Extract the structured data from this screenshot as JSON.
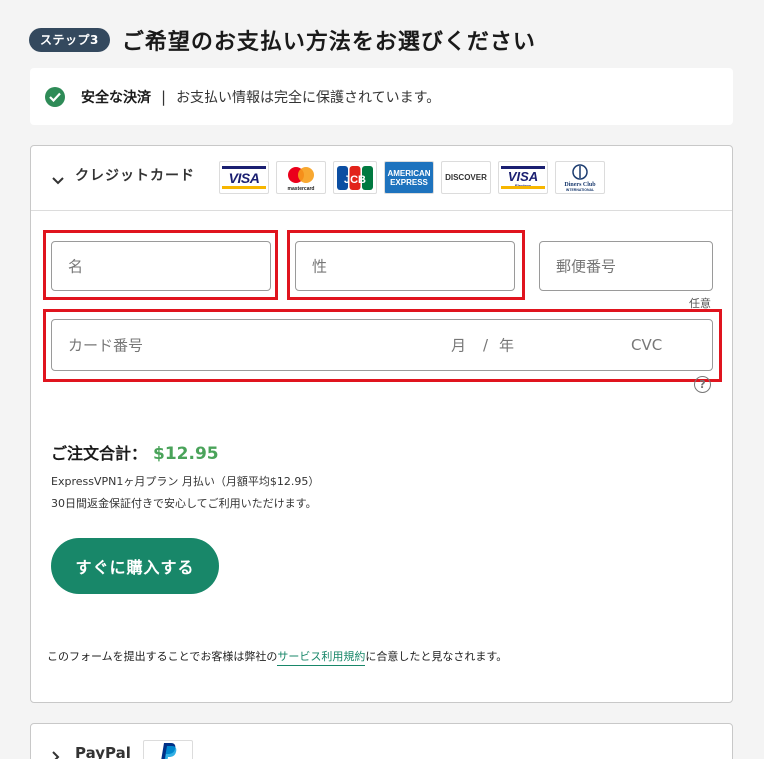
{
  "step": {
    "badge": "ステップ3",
    "title": "ご希望のお支払い方法をお選びください"
  },
  "secure": {
    "strong": "安全な決済",
    "separator": "|",
    "text": "お支払い情報は完全に保護されています。"
  },
  "credit_card": {
    "label": "クレジットカード",
    "logos": [
      "VISA",
      "mastercard",
      "JCB",
      "AMERICAN EXPRESS",
      "DISCOVER",
      "VISA Electron",
      "Diners Club INTERNATIONAL"
    ],
    "fields": {
      "first_name": "名",
      "last_name": "性",
      "postal_code": "郵便番号",
      "optional": "任意",
      "card_number": "カード番号",
      "month": "月",
      "slash": "/",
      "year": "年",
      "cvc": "CVC",
      "help": "?"
    }
  },
  "order": {
    "total_label": "ご注文合計：",
    "total_amount": "$12.95",
    "plan": "ExpressVPN1ヶ月プラン 月払い（月額平均$12.95）",
    "guarantee": "30日間返金保証付きで安心してご利用いただけます。"
  },
  "buy_button": "すぐに購入する",
  "terms": {
    "before": "このフォームを提出することでお客様は弊社の",
    "link": "サービス利用規約",
    "after": "に合意したと見なされます。"
  },
  "paypal": {
    "label": "PayPal"
  },
  "colors": {
    "accent": "#188769",
    "price": "#4aa35a",
    "badge": "#34495e",
    "highlight": "#e0141e"
  }
}
